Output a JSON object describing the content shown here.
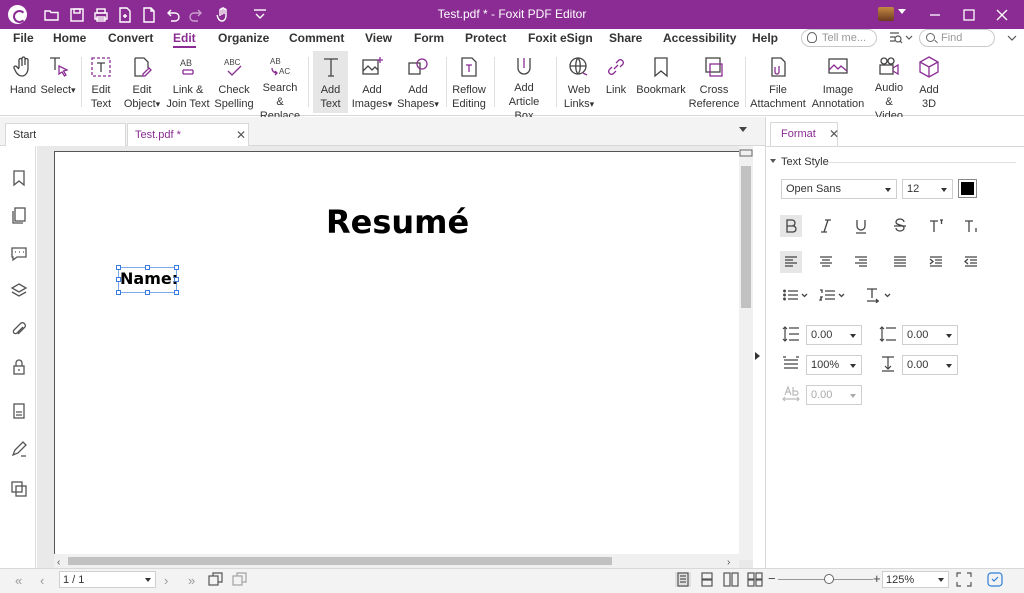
{
  "window": {
    "title": "Test.pdf * - Foxit PDF Editor"
  },
  "quick_access": [
    "open-folder-icon",
    "save-icon",
    "print-icon",
    "new-doc-icon",
    "new-page-icon",
    "undo-icon",
    "redo-icon",
    "hand-icon",
    "customize-icon"
  ],
  "menu": {
    "items": [
      "File",
      "Home",
      "Convert",
      "Edit",
      "Organize",
      "Comment",
      "View",
      "Form",
      "Protect",
      "Foxit eSign",
      "Share",
      "Accessibility",
      "Help"
    ],
    "active": "Edit",
    "tell_me_placeholder": "Tell me...",
    "find_placeholder": "Find"
  },
  "ribbon": {
    "hand": [
      "Hand"
    ],
    "select": [
      "Select"
    ],
    "edit_text": [
      "Edit",
      "Text"
    ],
    "edit_object": [
      "Edit",
      "Object"
    ],
    "link_join": [
      "Link &",
      "Join Text"
    ],
    "check_spelling": [
      "Check",
      "Spelling"
    ],
    "search_replace": [
      "Search &",
      "Replace"
    ],
    "add_text": [
      "Add",
      "Text"
    ],
    "add_images": [
      "Add",
      "Images"
    ],
    "add_shapes": [
      "Add",
      "Shapes"
    ],
    "reflow_editing": [
      "Reflow",
      "Editing"
    ],
    "add_article_box": [
      "Add",
      "Article Box"
    ],
    "web_links": [
      "Web",
      "Links"
    ],
    "link": [
      "Link"
    ],
    "bookmark": [
      "Bookmark"
    ],
    "cross_reference": [
      "Cross",
      "Reference"
    ],
    "file_attachment": [
      "File",
      "Attachment"
    ],
    "image_annotation": [
      "Image",
      "Annotation"
    ],
    "audio_video": [
      "Audio",
      "& Video"
    ],
    "add_3d": [
      "Add",
      "3D"
    ],
    "icon_text_spell": "ABC",
    "icon_text_search": "AB",
    "icon_text_search2": "AC",
    "icon_text_link": "AB"
  },
  "tabs": {
    "start": "Start",
    "doc": "Test.pdf *",
    "close_symbol": "✕"
  },
  "document": {
    "title": "Resumé",
    "field_label": "Name:"
  },
  "format_panel": {
    "tab_label": "Format",
    "section": "Text Style",
    "font": "Open Sans",
    "size": "12",
    "color": "#000000",
    "line_spacing": "0.00",
    "paragraph_spacing": "0.00",
    "horizontal_scale": "100%",
    "indent": "0.00",
    "char_spacing": "0.00"
  },
  "status": {
    "page_indicator": "1 / 1",
    "zoom": "125%"
  }
}
